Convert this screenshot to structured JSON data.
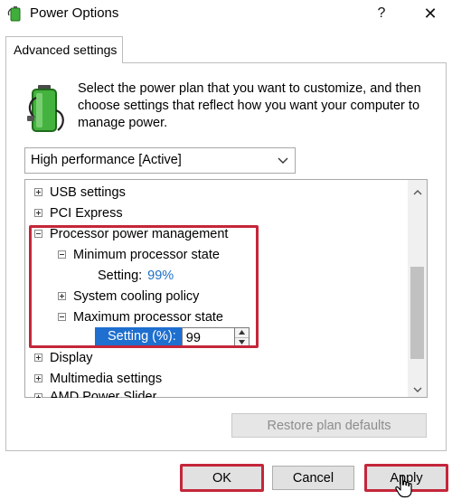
{
  "window": {
    "title": "Power Options",
    "help_glyph": "?",
    "close_glyph": "✕"
  },
  "tab": {
    "label": "Advanced settings"
  },
  "intro": {
    "text": "Select the power plan that you want to customize, and then choose settings that reflect how you want your computer to manage power."
  },
  "plan_select": {
    "value": "High performance [Active]"
  },
  "tree": {
    "usb": "USB settings",
    "pci": "PCI Express",
    "processor": "Processor power management",
    "min_state": "Minimum processor state",
    "min_setting_label": "Setting:",
    "min_setting_value": "99%",
    "cooling": "System cooling policy",
    "max_state": "Maximum processor state",
    "max_setting_label": "Setting (%):",
    "max_setting_value": "99",
    "display": "Display",
    "multimedia": "Multimedia settings",
    "amd": "AMD Power Slider"
  },
  "buttons": {
    "restore": "Restore plan defaults",
    "ok": "OK",
    "cancel": "Cancel",
    "apply": "Apply"
  },
  "colors": {
    "highlight": "#c4263a",
    "selection": "#1e6fcf",
    "value_link": "#1a6fc4"
  },
  "icons": {
    "app": "battery-power-icon",
    "intro": "battery-power-icon",
    "cursor": "hand-pointer-cursor"
  }
}
